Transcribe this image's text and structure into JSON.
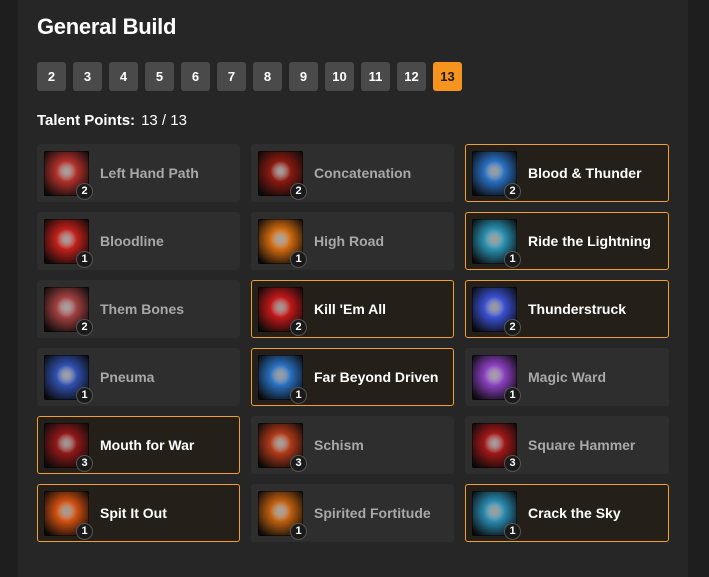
{
  "title": "General Build",
  "levels": [
    "2",
    "3",
    "4",
    "5",
    "6",
    "7",
    "8",
    "9",
    "10",
    "11",
    "12",
    "13"
  ],
  "active_level": "13",
  "talent_points": {
    "label": "Talent Points:",
    "value": "13 / 13"
  },
  "talents": [
    {
      "name": "Left Hand Path",
      "rank": "2",
      "selected": false,
      "icon": "skull-hand-icon",
      "color": "#b0302a"
    },
    {
      "name": "Concatenation",
      "rank": "2",
      "selected": false,
      "icon": "fire-chain-icon",
      "color": "#8a1a10"
    },
    {
      "name": "Blood & Thunder",
      "rank": "2",
      "selected": true,
      "icon": "lightning-storm-icon",
      "color": "#2a6fc0"
    },
    {
      "name": "Bloodline",
      "rank": "1",
      "selected": false,
      "icon": "blood-slash-icon",
      "color": "#c0201a"
    },
    {
      "name": "High Road",
      "rank": "1",
      "selected": false,
      "icon": "fire-runner-icon",
      "color": "#d06a10"
    },
    {
      "name": "Ride the Lightning",
      "rank": "1",
      "selected": true,
      "icon": "lightning-golem-icon",
      "color": "#2a90b0"
    },
    {
      "name": "Them Bones",
      "rank": "2",
      "selected": false,
      "icon": "skull-icon",
      "color": "#a04040"
    },
    {
      "name": "Kill 'Em All",
      "rank": "2",
      "selected": true,
      "icon": "blood-vortex-icon",
      "color": "#c01818"
    },
    {
      "name": "Thunderstruck",
      "rank": "2",
      "selected": true,
      "icon": "lightning-bolt-icon",
      "color": "#3a50d0"
    },
    {
      "name": "Pneuma",
      "rank": "1",
      "selected": false,
      "icon": "spirit-icon",
      "color": "#3050b0"
    },
    {
      "name": "Far Beyond Driven",
      "rank": "1",
      "selected": true,
      "icon": "ice-golem-icon",
      "color": "#2a70c0"
    },
    {
      "name": "Magic Ward",
      "rank": "1",
      "selected": false,
      "icon": "scroll-ward-icon",
      "color": "#8a40c0"
    },
    {
      "name": "Mouth for War",
      "rank": "3",
      "selected": true,
      "icon": "blood-orb-icon",
      "color": "#901818"
    },
    {
      "name": "Schism",
      "rank": "3",
      "selected": false,
      "icon": "split-face-icon",
      "color": "#b03a18"
    },
    {
      "name": "Square Hammer",
      "rank": "3",
      "selected": false,
      "icon": "hammer-icon",
      "color": "#a01818"
    },
    {
      "name": "Spit It Out",
      "rank": "1",
      "selected": true,
      "icon": "fire-hammer-icon",
      "color": "#d05010"
    },
    {
      "name": "Spirited Fortitude",
      "rank": "1",
      "selected": false,
      "icon": "flame-warrior-icon",
      "color": "#c06010"
    },
    {
      "name": "Crack the Sky",
      "rank": "1",
      "selected": true,
      "icon": "sky-crack-icon",
      "color": "#2a8ab0"
    }
  ]
}
